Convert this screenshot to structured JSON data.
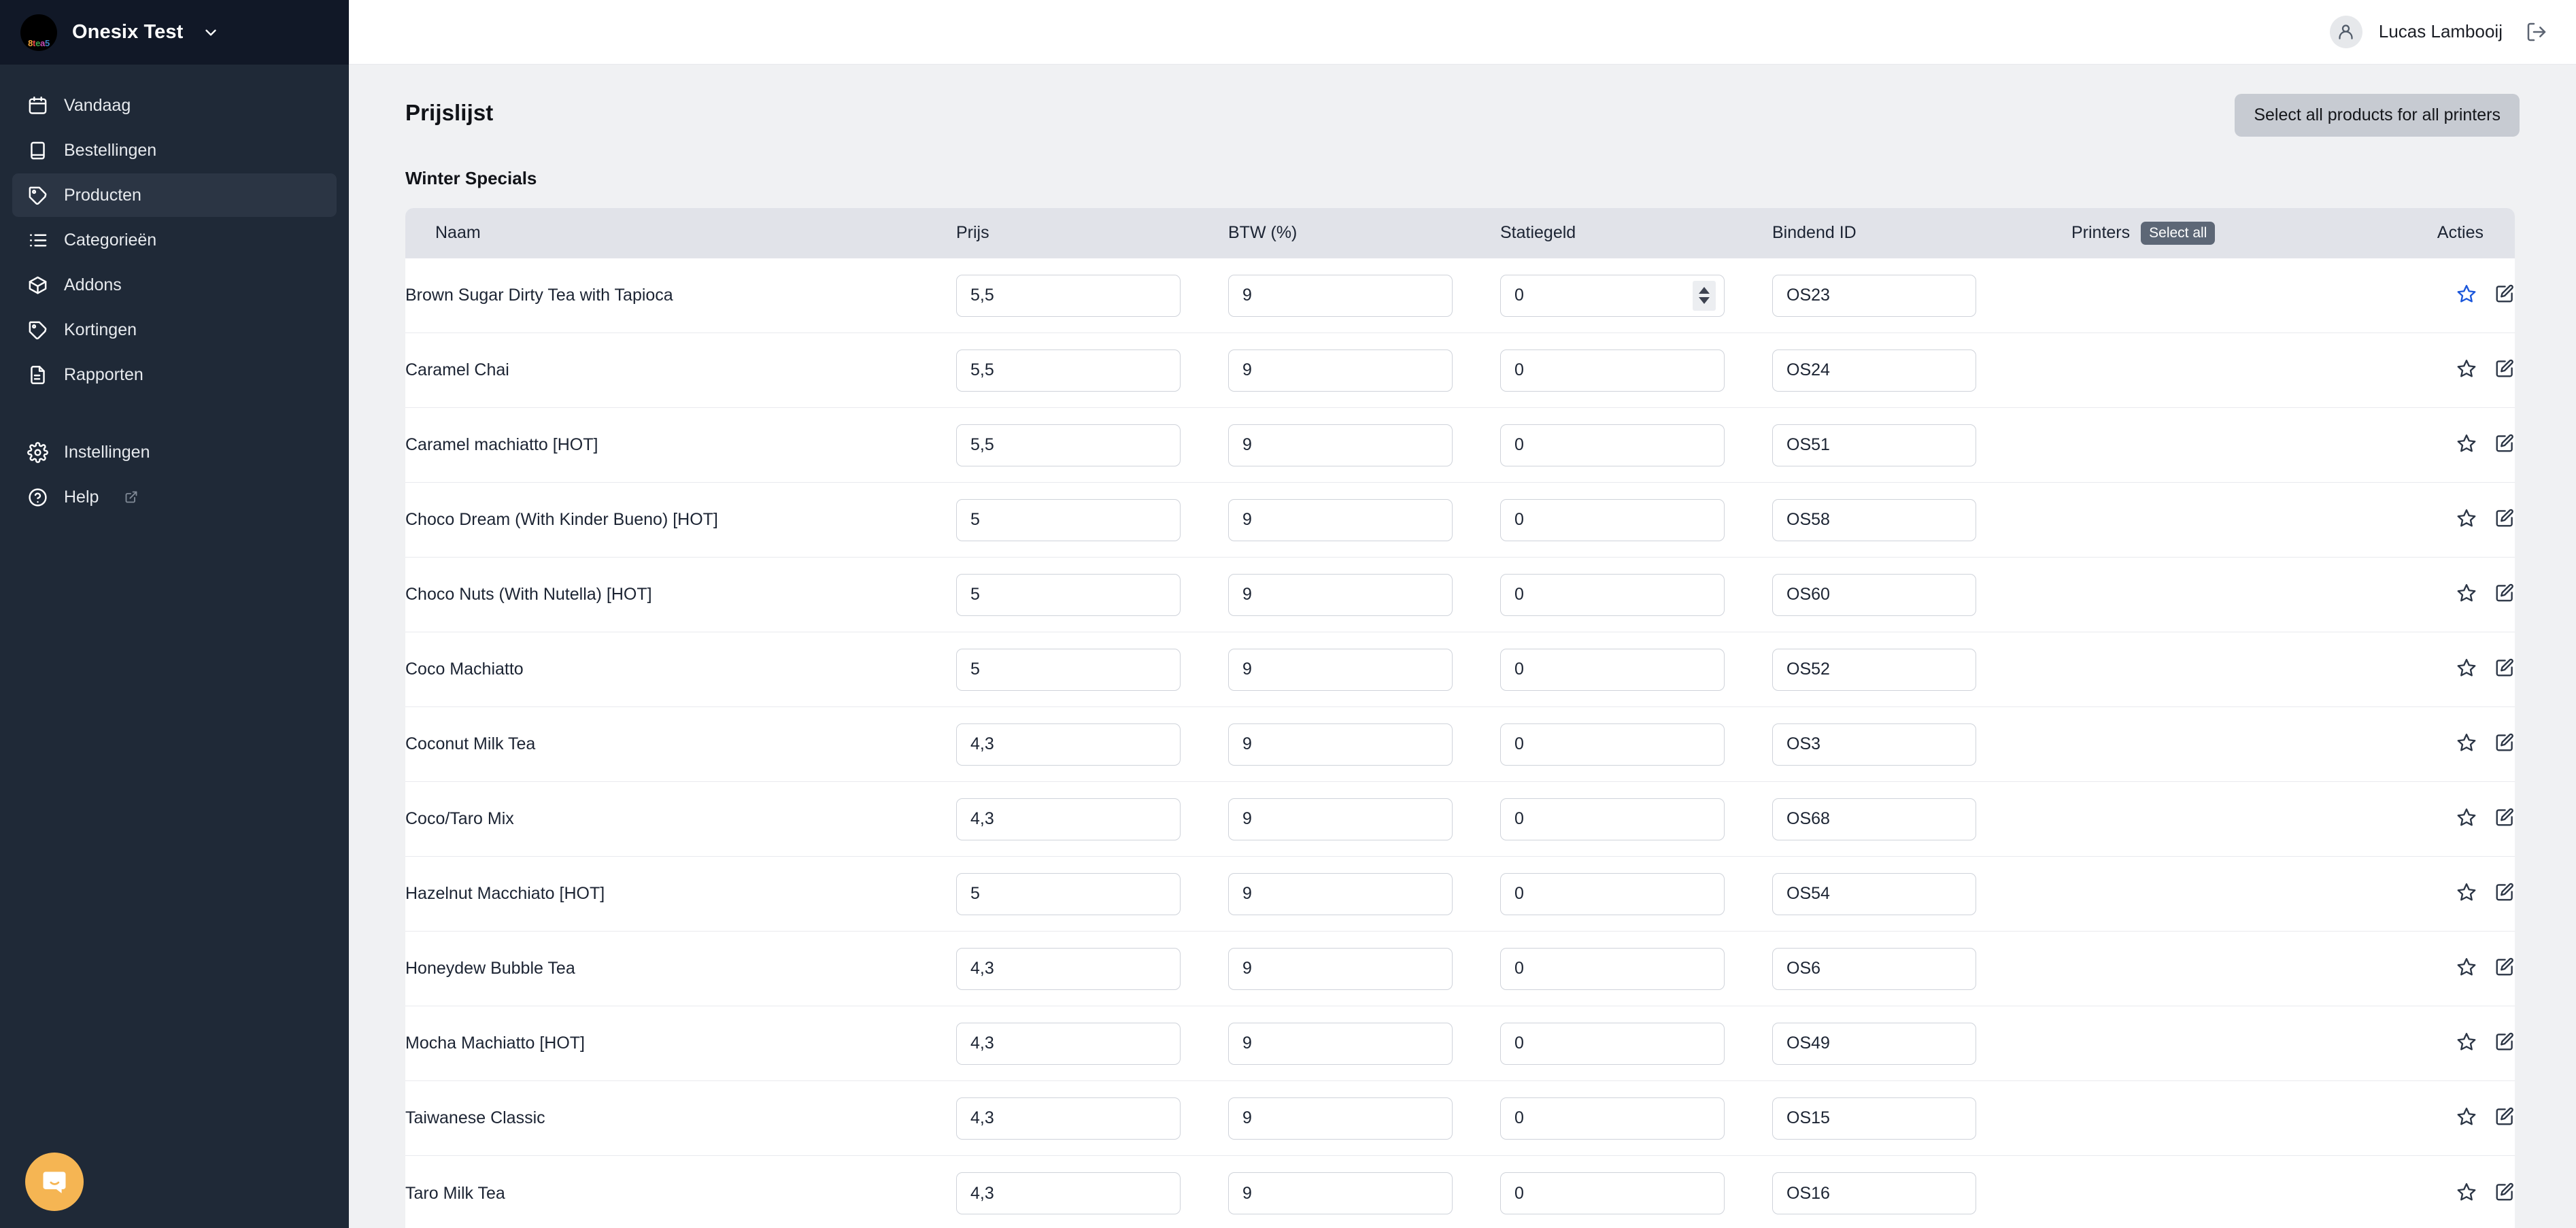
{
  "sidebar": {
    "org_name": "Onesix Test",
    "logo_text": "8tea5",
    "logo_letters": [
      {
        "ch": "8",
        "color": "#f2a43a"
      },
      {
        "ch": "t",
        "color": "#e8454a"
      },
      {
        "ch": "e",
        "color": "#3fa34d"
      },
      {
        "ch": "a",
        "color": "#c64bb5"
      },
      {
        "ch": "5",
        "color": "#3b82c4"
      }
    ],
    "items": [
      {
        "label": "Vandaag",
        "icon": "calendar-icon",
        "active": false
      },
      {
        "label": "Bestellingen",
        "icon": "book-icon",
        "active": false
      },
      {
        "label": "Producten",
        "icon": "tag-icon",
        "active": true
      },
      {
        "label": "Categorieën",
        "icon": "list-icon",
        "active": false
      },
      {
        "label": "Addons",
        "icon": "package-icon",
        "active": false
      },
      {
        "label": "Kortingen",
        "icon": "tag-icon",
        "active": false
      },
      {
        "label": "Rapporten",
        "icon": "document-icon",
        "active": false
      }
    ],
    "footer_items": [
      {
        "label": "Instellingen",
        "icon": "gear-icon",
        "external": false
      },
      {
        "label": "Help",
        "icon": "question-mark-icon",
        "external": true
      }
    ],
    "chat_launcher": "intercom-chat-icon",
    "bg_color": "#1f2937",
    "header_bg_color": "#111827",
    "active_bg_color": "#2b3544"
  },
  "topbar": {
    "user_name": "Lucas Lambooij",
    "avatar_icon": "user-icon",
    "logout_icon": "logout-icon"
  },
  "page": {
    "title": "Prijslijst",
    "select_all_printers_label": "Select all products for all printers",
    "section_title": "Winter Specials",
    "accent_color": "#1a56db",
    "button_bg_color": "#c7cbd2",
    "badge_bg_color": "#5d6776"
  },
  "table": {
    "columns": [
      "Naam",
      "Prijs",
      "BTW (%)",
      "Statiegeld",
      "Bindend ID",
      "Printers",
      "Acties"
    ],
    "printers_select_all_label": "Select all",
    "row_actions": {
      "favorite_icon": "star-icon",
      "edit_icon": "square-pen-icon"
    },
    "rows": [
      {
        "naam": "Brown Sugar Dirty Tea with Tapioca",
        "prijs": "5,5",
        "btw": "9",
        "statiegeld": "0",
        "bindend_id": "OS23",
        "spinner": true,
        "fav_active": true
      },
      {
        "naam": "Caramel Chai",
        "prijs": "5,5",
        "btw": "9",
        "statiegeld": "0",
        "bindend_id": "OS24",
        "spinner": false,
        "fav_active": false
      },
      {
        "naam": "Caramel machiatto [HOT]",
        "prijs": "5,5",
        "btw": "9",
        "statiegeld": "0",
        "bindend_id": "OS51",
        "spinner": false,
        "fav_active": false
      },
      {
        "naam": "Choco Dream (With Kinder Bueno) [HOT]",
        "prijs": "5",
        "btw": "9",
        "statiegeld": "0",
        "bindend_id": "OS58",
        "spinner": false,
        "fav_active": false
      },
      {
        "naam": "Choco Nuts (With Nutella) [HOT]",
        "prijs": "5",
        "btw": "9",
        "statiegeld": "0",
        "bindend_id": "OS60",
        "spinner": false,
        "fav_active": false
      },
      {
        "naam": "Coco Machiatto",
        "prijs": "5",
        "btw": "9",
        "statiegeld": "0",
        "bindend_id": "OS52",
        "spinner": false,
        "fav_active": false
      },
      {
        "naam": "Coconut Milk Tea",
        "prijs": "4,3",
        "btw": "9",
        "statiegeld": "0",
        "bindend_id": "OS3",
        "spinner": false,
        "fav_active": false
      },
      {
        "naam": "Coco/Taro Mix",
        "prijs": "4,3",
        "btw": "9",
        "statiegeld": "0",
        "bindend_id": "OS68",
        "spinner": false,
        "fav_active": false
      },
      {
        "naam": "Hazelnut Macchiato [HOT]",
        "prijs": "5",
        "btw": "9",
        "statiegeld": "0",
        "bindend_id": "OS54",
        "spinner": false,
        "fav_active": false
      },
      {
        "naam": "Honeydew Bubble Tea",
        "prijs": "4,3",
        "btw": "9",
        "statiegeld": "0",
        "bindend_id": "OS6",
        "spinner": false,
        "fav_active": false
      },
      {
        "naam": "Mocha Machiatto [HOT]",
        "prijs": "4,3",
        "btw": "9",
        "statiegeld": "0",
        "bindend_id": "OS49",
        "spinner": false,
        "fav_active": false
      },
      {
        "naam": "Taiwanese Classic",
        "prijs": "4,3",
        "btw": "9",
        "statiegeld": "0",
        "bindend_id": "OS15",
        "spinner": false,
        "fav_active": false
      },
      {
        "naam": "Taro Milk Tea",
        "prijs": "4,3",
        "btw": "9",
        "statiegeld": "0",
        "bindend_id": "OS16",
        "spinner": false,
        "fav_active": false
      }
    ]
  }
}
